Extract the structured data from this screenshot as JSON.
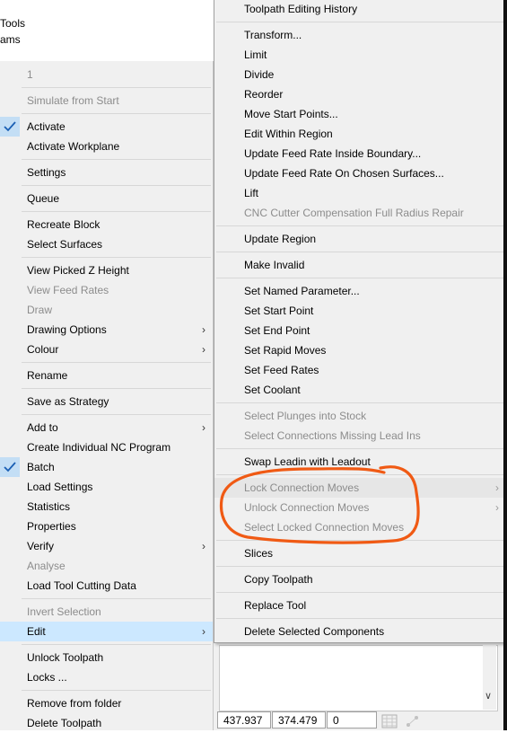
{
  "background": {
    "line1": "Tools",
    "line2": "ams"
  },
  "left_menu": {
    "items": [
      {
        "label": "1",
        "disabled": true
      },
      {
        "label": "Simulate from Start",
        "disabled": true
      },
      {
        "label": "Activate",
        "checked": true
      },
      {
        "label": "Activate Workplane"
      },
      {
        "label": "Settings"
      },
      {
        "label": "Queue"
      },
      {
        "label": "Recreate Block"
      },
      {
        "label": "Select Surfaces"
      },
      {
        "label": "View Picked Z Height"
      },
      {
        "label": "View Feed Rates",
        "disabled": true
      },
      {
        "label": "Draw",
        "disabled": true
      },
      {
        "label": "Drawing Options",
        "submenu": true
      },
      {
        "label": "Colour",
        "submenu": true
      },
      {
        "label": "Rename"
      },
      {
        "label": "Save as Strategy"
      },
      {
        "label": "Add to",
        "submenu": true
      },
      {
        "label": "Create Individual NC Program"
      },
      {
        "label": "Batch",
        "checked": true
      },
      {
        "label": "Load Settings"
      },
      {
        "label": "Statistics"
      },
      {
        "label": "Properties"
      },
      {
        "label": "Verify",
        "submenu": true
      },
      {
        "label": "Analyse",
        "disabled": true
      },
      {
        "label": "Load Tool Cutting Data"
      },
      {
        "label": "Invert Selection",
        "disabled": true
      },
      {
        "label": "Edit",
        "submenu": true,
        "highlighted": true
      },
      {
        "label": "Unlock Toolpath"
      },
      {
        "label": "Locks ..."
      },
      {
        "label": "Remove from folder"
      },
      {
        "label": "Delete Toolpath"
      }
    ]
  },
  "right_menu": {
    "items": [
      {
        "label": "Toolpath Editing History"
      },
      {
        "label": "Transform..."
      },
      {
        "label": "Limit"
      },
      {
        "label": "Divide"
      },
      {
        "label": "Reorder"
      },
      {
        "label": "Move Start Points..."
      },
      {
        "label": "Edit Within Region"
      },
      {
        "label": "Update Feed Rate Inside Boundary..."
      },
      {
        "label": "Update Feed Rate On Chosen Surfaces..."
      },
      {
        "label": "Lift"
      },
      {
        "label": "CNC Cutter Compensation Full Radius Repair",
        "disabled": true
      },
      {
        "label": "Update Region"
      },
      {
        "label": "Make Invalid"
      },
      {
        "label": "Set Named Parameter..."
      },
      {
        "label": "Set Start Point"
      },
      {
        "label": "Set End Point"
      },
      {
        "label": "Set Rapid Moves"
      },
      {
        "label": "Set Feed Rates"
      },
      {
        "label": "Set Coolant"
      },
      {
        "label": "Select Plunges into Stock",
        "disabled": true
      },
      {
        "label": "Select Connections Missing Lead Ins",
        "disabled": true
      },
      {
        "label": "Swap Leadin with Leadout"
      },
      {
        "label": "Lock Connection Moves",
        "disabled": true,
        "submenu": true
      },
      {
        "label": "Unlock Connection Moves",
        "disabled": true,
        "submenu": true
      },
      {
        "label": "Select Locked Connection Moves",
        "disabled": true
      },
      {
        "label": "Slices"
      },
      {
        "label": "Copy Toolpath"
      },
      {
        "label": "Replace Tool"
      },
      {
        "label": "Delete Selected Components"
      }
    ]
  },
  "status_bar": {
    "x": "437.937",
    "y": "374.479",
    "z": "0"
  },
  "annotation_color": "#f05a14"
}
